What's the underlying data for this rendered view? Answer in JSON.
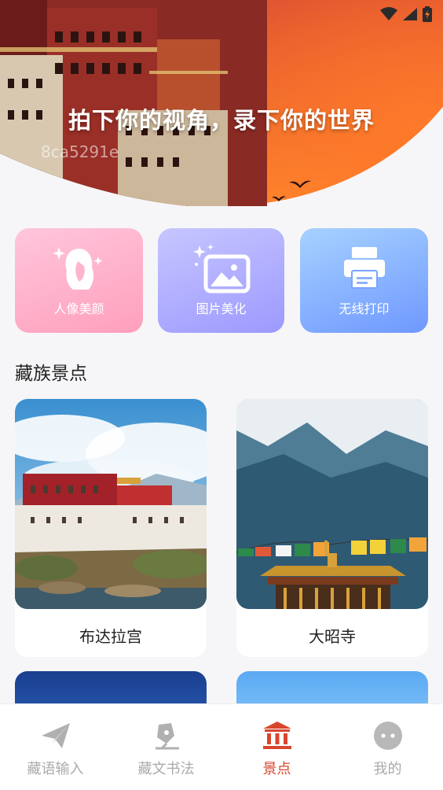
{
  "hero": {
    "title": "拍下你的视角，录下你的世界",
    "subtitle": "8ca5291e"
  },
  "features": [
    {
      "label": "人像美颜",
      "icon": "portrait-beauty-icon"
    },
    {
      "label": "图片美化",
      "icon": "image-enhance-icon"
    },
    {
      "label": "无线打印",
      "icon": "printer-icon"
    }
  ],
  "section": {
    "title": "藏族景点"
  },
  "attractions": [
    {
      "name": "布达拉宫"
    },
    {
      "name": "大昭寺"
    }
  ],
  "tabs": [
    {
      "label": "藏语输入",
      "icon": "paper-plane-icon"
    },
    {
      "label": "藏文书法",
      "icon": "calligraphy-pen-icon"
    },
    {
      "label": "景点",
      "icon": "temple-icon",
      "active": true
    },
    {
      "label": "我的",
      "icon": "profile-chat-icon"
    }
  ],
  "colors": {
    "accent": "#d9452c",
    "tab_inactive": "#aaaaaa"
  }
}
